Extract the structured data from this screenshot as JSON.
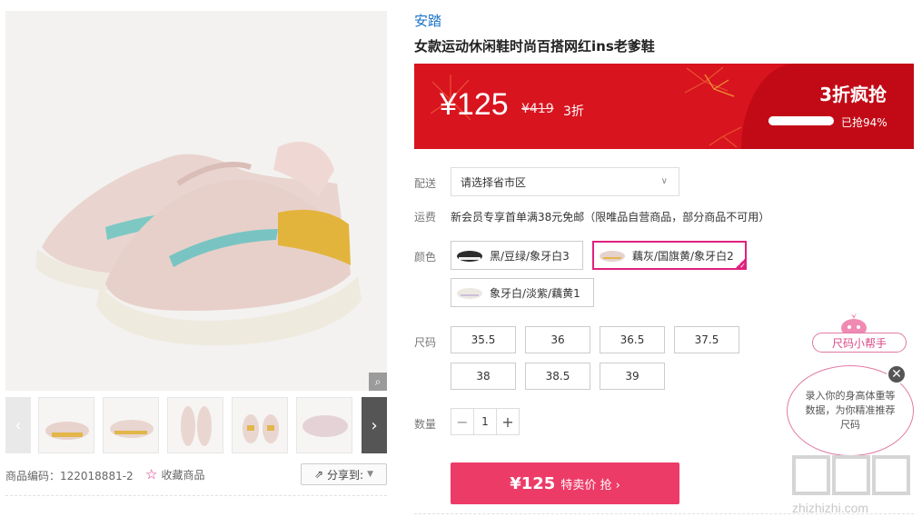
{
  "product": {
    "brand": "安踏",
    "title": "女款运动休闲鞋时尚百搭网红ins老爹鞋",
    "code_label": "商品编码：122018881-2",
    "favorite_label": "收藏商品",
    "share_label": "分享到:"
  },
  "price": {
    "current": "¥125",
    "original": "¥419",
    "discount": "3折"
  },
  "flash_sale": {
    "title": "3折疯抢",
    "sold_label": "已抢94%",
    "sold_fraction": 0.94
  },
  "shipping": {
    "delivery_label": "配送",
    "region_placeholder": "请选择省市区",
    "fee_label": "运费",
    "fee_text": "新会员专享首单满38元免邮（限唯品自营商品，部分商品不可用）"
  },
  "colors": {
    "label": "颜色",
    "options": [
      {
        "name": "黑/豆绿/象牙白3",
        "selected": false
      },
      {
        "name": "藕灰/国旗黄/象牙白2",
        "selected": true
      },
      {
        "name": "象牙白/淡紫/藕黄1",
        "selected": false
      }
    ]
  },
  "sizes": {
    "label": "尺码",
    "options": [
      "35.5",
      "36",
      "36.5",
      "37.5",
      "38",
      "38.5",
      "39"
    ]
  },
  "quantity": {
    "label": "数量",
    "value": "1",
    "minus": "−",
    "plus": "+"
  },
  "buy": {
    "price": "¥125",
    "label": "特卖价 抢 ›"
  },
  "size_helper": {
    "tag": "尺码小帮手",
    "bubble": "录入你的身高体重等数据，为你精准推荐尺码",
    "close": "✕"
  },
  "watermark": {
    "text": "zhizhizhi.com"
  },
  "colors_theme": {
    "banner_red": "#d8141f",
    "buy_pink": "#ed3b68",
    "brand_blue": "#1a73c9",
    "select_magenta": "#e0217e"
  }
}
